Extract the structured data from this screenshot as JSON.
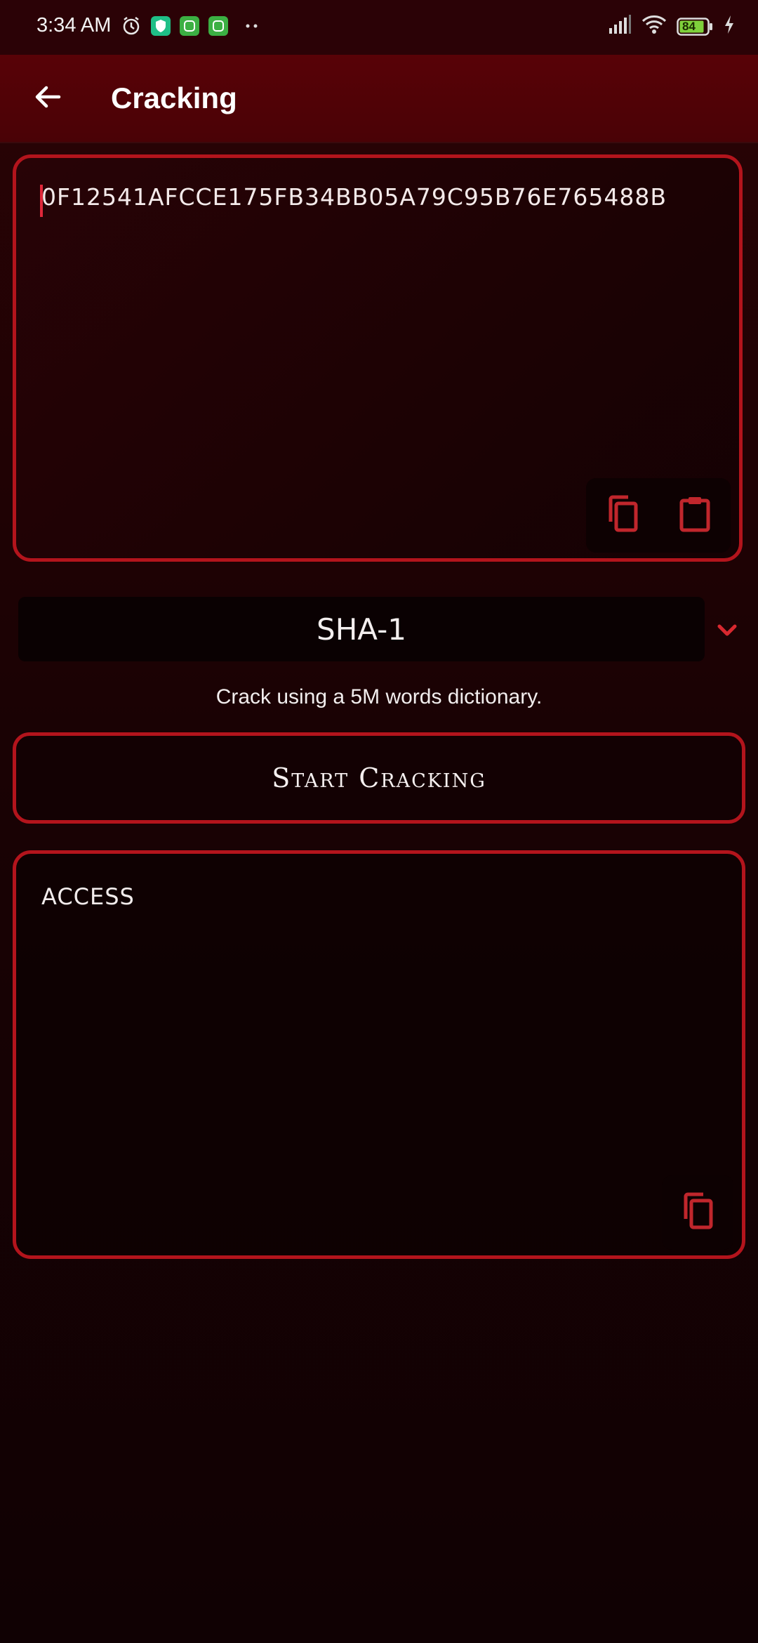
{
  "status_bar": {
    "time": "3:34 AM",
    "battery": "84",
    "icons": [
      "alarm-icon",
      "shield-app-icon",
      "app-icon",
      "app-icon",
      "more-dots-icon",
      "signal-icon",
      "wifi-icon",
      "battery-icon",
      "charging-icon"
    ]
  },
  "app_bar": {
    "title": "Cracking",
    "back_icon": "arrow-left-icon"
  },
  "hash_input": {
    "value": "0F12541AFCCE175FB34BB05A79C95B76E765488B",
    "copy_icon": "copy-icon",
    "paste_icon": "clipboard-icon"
  },
  "algorithm": {
    "selected": "SHA-1",
    "dropdown_icon": "chevron-down-icon"
  },
  "description": "Crack using a 5M words dictionary.",
  "start_button": {
    "label": "Start Cracking"
  },
  "result": {
    "value": "ACCESS",
    "copy_icon": "copy-icon"
  },
  "colors": {
    "accent": "#b3141c",
    "app_bar": "#580207",
    "background": "#1a0204",
    "icon": "#c0262c"
  }
}
